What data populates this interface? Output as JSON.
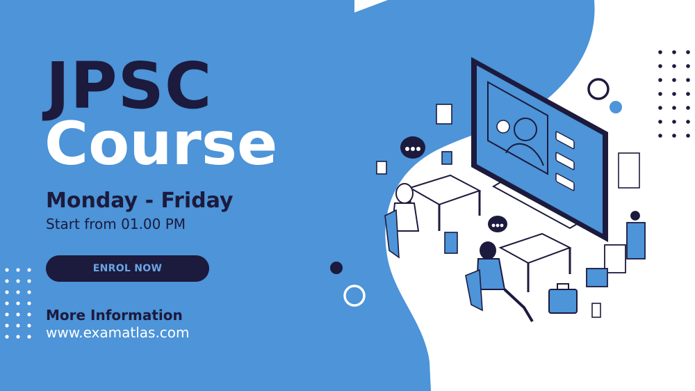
{
  "banner": {
    "title_line1": "JPSC",
    "title_line2": "Course",
    "schedule_days": "Monday - Friday",
    "start_time": "Start from 01.00 PM",
    "cta_label": "ENROL NOW",
    "info_heading": "More Information",
    "website": "www.examatlas.com"
  },
  "colors": {
    "primary_blue": "#4d94d8",
    "dark_navy": "#1c1a3d",
    "white": "#ffffff",
    "cta_text": "#6aa6e4"
  },
  "illustration": {
    "subject": "isometric online classroom",
    "icons": [
      "monitor-icon",
      "student-icon",
      "desk-icon",
      "chat-bubble-icon",
      "document-icon",
      "briefcase-icon",
      "books-icon"
    ]
  }
}
